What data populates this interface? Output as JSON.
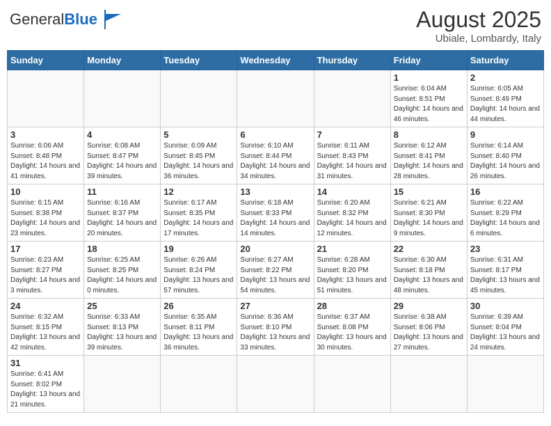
{
  "header": {
    "logo_general": "General",
    "logo_blue": "Blue",
    "month_title": "August 2025",
    "location": "Ubiale, Lombardy, Italy"
  },
  "days_of_week": [
    "Sunday",
    "Monday",
    "Tuesday",
    "Wednesday",
    "Thursday",
    "Friday",
    "Saturday"
  ],
  "weeks": [
    [
      {
        "day": "",
        "info": ""
      },
      {
        "day": "",
        "info": ""
      },
      {
        "day": "",
        "info": ""
      },
      {
        "day": "",
        "info": ""
      },
      {
        "day": "",
        "info": ""
      },
      {
        "day": "1",
        "info": "Sunrise: 6:04 AM\nSunset: 8:51 PM\nDaylight: 14 hours and 46 minutes."
      },
      {
        "day": "2",
        "info": "Sunrise: 6:05 AM\nSunset: 8:49 PM\nDaylight: 14 hours and 44 minutes."
      }
    ],
    [
      {
        "day": "3",
        "info": "Sunrise: 6:06 AM\nSunset: 8:48 PM\nDaylight: 14 hours and 41 minutes."
      },
      {
        "day": "4",
        "info": "Sunrise: 6:08 AM\nSunset: 8:47 PM\nDaylight: 14 hours and 39 minutes."
      },
      {
        "day": "5",
        "info": "Sunrise: 6:09 AM\nSunset: 8:45 PM\nDaylight: 14 hours and 36 minutes."
      },
      {
        "day": "6",
        "info": "Sunrise: 6:10 AM\nSunset: 8:44 PM\nDaylight: 14 hours and 34 minutes."
      },
      {
        "day": "7",
        "info": "Sunrise: 6:11 AM\nSunset: 8:43 PM\nDaylight: 14 hours and 31 minutes."
      },
      {
        "day": "8",
        "info": "Sunrise: 6:12 AM\nSunset: 8:41 PM\nDaylight: 14 hours and 28 minutes."
      },
      {
        "day": "9",
        "info": "Sunrise: 6:14 AM\nSunset: 8:40 PM\nDaylight: 14 hours and 26 minutes."
      }
    ],
    [
      {
        "day": "10",
        "info": "Sunrise: 6:15 AM\nSunset: 8:38 PM\nDaylight: 14 hours and 23 minutes."
      },
      {
        "day": "11",
        "info": "Sunrise: 6:16 AM\nSunset: 8:37 PM\nDaylight: 14 hours and 20 minutes."
      },
      {
        "day": "12",
        "info": "Sunrise: 6:17 AM\nSunset: 8:35 PM\nDaylight: 14 hours and 17 minutes."
      },
      {
        "day": "13",
        "info": "Sunrise: 6:18 AM\nSunset: 8:33 PM\nDaylight: 14 hours and 14 minutes."
      },
      {
        "day": "14",
        "info": "Sunrise: 6:20 AM\nSunset: 8:32 PM\nDaylight: 14 hours and 12 minutes."
      },
      {
        "day": "15",
        "info": "Sunrise: 6:21 AM\nSunset: 8:30 PM\nDaylight: 14 hours and 9 minutes."
      },
      {
        "day": "16",
        "info": "Sunrise: 6:22 AM\nSunset: 8:29 PM\nDaylight: 14 hours and 6 minutes."
      }
    ],
    [
      {
        "day": "17",
        "info": "Sunrise: 6:23 AM\nSunset: 8:27 PM\nDaylight: 14 hours and 3 minutes."
      },
      {
        "day": "18",
        "info": "Sunrise: 6:25 AM\nSunset: 8:25 PM\nDaylight: 14 hours and 0 minutes."
      },
      {
        "day": "19",
        "info": "Sunrise: 6:26 AM\nSunset: 8:24 PM\nDaylight: 13 hours and 57 minutes."
      },
      {
        "day": "20",
        "info": "Sunrise: 6:27 AM\nSunset: 8:22 PM\nDaylight: 13 hours and 54 minutes."
      },
      {
        "day": "21",
        "info": "Sunrise: 6:28 AM\nSunset: 8:20 PM\nDaylight: 13 hours and 51 minutes."
      },
      {
        "day": "22",
        "info": "Sunrise: 6:30 AM\nSunset: 8:18 PM\nDaylight: 13 hours and 48 minutes."
      },
      {
        "day": "23",
        "info": "Sunrise: 6:31 AM\nSunset: 8:17 PM\nDaylight: 13 hours and 45 minutes."
      }
    ],
    [
      {
        "day": "24",
        "info": "Sunrise: 6:32 AM\nSunset: 8:15 PM\nDaylight: 13 hours and 42 minutes."
      },
      {
        "day": "25",
        "info": "Sunrise: 6:33 AM\nSunset: 8:13 PM\nDaylight: 13 hours and 39 minutes."
      },
      {
        "day": "26",
        "info": "Sunrise: 6:35 AM\nSunset: 8:11 PM\nDaylight: 13 hours and 36 minutes."
      },
      {
        "day": "27",
        "info": "Sunrise: 6:36 AM\nSunset: 8:10 PM\nDaylight: 13 hours and 33 minutes."
      },
      {
        "day": "28",
        "info": "Sunrise: 6:37 AM\nSunset: 8:08 PM\nDaylight: 13 hours and 30 minutes."
      },
      {
        "day": "29",
        "info": "Sunrise: 6:38 AM\nSunset: 8:06 PM\nDaylight: 13 hours and 27 minutes."
      },
      {
        "day": "30",
        "info": "Sunrise: 6:39 AM\nSunset: 8:04 PM\nDaylight: 13 hours and 24 minutes."
      }
    ],
    [
      {
        "day": "31",
        "info": "Sunrise: 6:41 AM\nSunset: 8:02 PM\nDaylight: 13 hours and 21 minutes."
      },
      {
        "day": "",
        "info": ""
      },
      {
        "day": "",
        "info": ""
      },
      {
        "day": "",
        "info": ""
      },
      {
        "day": "",
        "info": ""
      },
      {
        "day": "",
        "info": ""
      },
      {
        "day": "",
        "info": ""
      }
    ]
  ]
}
